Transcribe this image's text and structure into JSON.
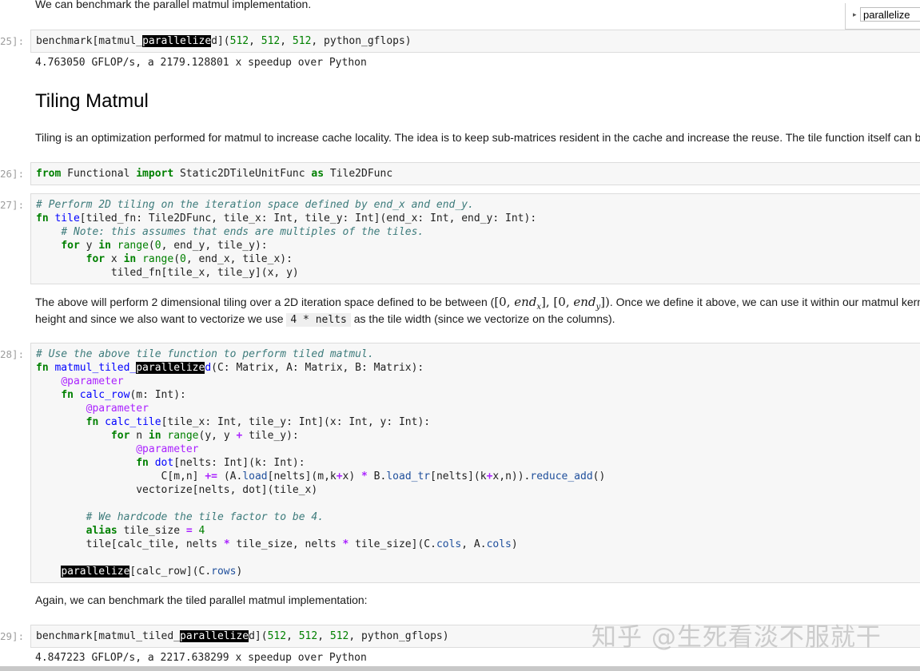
{
  "search": {
    "value": "parallelize"
  },
  "top_text": "We can benchmark the parallel matmul implementation.",
  "cells": {
    "c25": {
      "prompt": "25]:",
      "pre": "benchmark[matmul_",
      "hl": "parallelize",
      "post": "d](",
      "a1": "512",
      "a2": "512",
      "a3": "512",
      "tail": ", python_gflops)",
      "output": "4.763050 GFLOP/s, a 2179.128801 x speedup over Python"
    },
    "c26": {
      "prompt": "26]:",
      "k1": "from",
      "mod": " Functional ",
      "k2": "import",
      "name": " Static2DTileUnitFunc ",
      "k3": "as",
      "alias": " Tile2DFunc"
    },
    "c27": {
      "prompt": "27]:",
      "l1": "# Perform 2D tiling on the iteration space defined by end_x and end_y.",
      "l2_kw": "fn",
      "l2_fn": "tile",
      "l2_rest": "[tiled_fn: Tile2DFunc, tile_x: Int, tile_y: Int](end_x: Int, end_y: Int):",
      "l3": "# Note: this assumes that ends are multiples of the tiles.",
      "l4_kw": "for",
      "l4_a": " y ",
      "l4_in": "in",
      "l4_fn": " range",
      "l4_p": "(",
      "l4_n": "0",
      "l4_r": ", end_y, tile_y):",
      "l5_kw": "for",
      "l5_a": " x ",
      "l5_in": "in",
      "l5_fn": " range",
      "l5_p": "(",
      "l5_n": "0",
      "l5_r": ", end_x, tile_x):",
      "l6": "tiled_fn[tile_x, tile_y](x, y)"
    },
    "c28": {
      "prompt": "28]:",
      "l1": "# Use the above tile function to perform tiled matmul.",
      "l2_kw": "fn",
      "l2_fn_a": "matmul_tiled_",
      "l2_hl": "parallelize",
      "l2_fn_b": "d",
      "l2_rest": "(C: Matrix, A: Matrix, B: Matrix):",
      "l3": "@parameter",
      "l4_kw": "fn",
      "l4_fn": "calc_row",
      "l4_rest": "(m: Int):",
      "l5": "@parameter",
      "l6_kw": "fn",
      "l6_fn": "calc_tile",
      "l6_rest": "[tile_x: Int, tile_y: Int](x: Int, y: Int):",
      "l7_kw": "for",
      "l7_a": " n ",
      "l7_in": "in",
      "l7_fn": " range",
      "l7_p1": "(y, y ",
      "l7_op": "+",
      "l7_p2": " tile_y):",
      "l8": "@parameter",
      "l9_kw": "fn",
      "l9_fn": "dot",
      "l9_rest": "[nelts: Int](k: Int):",
      "l10_a": "C[m,n] ",
      "l10_op1": "+=",
      "l10_b": " (A.",
      "l10_at1": "load",
      "l10_c": "[nelts](m,k",
      "l10_op2": "+",
      "l10_d": "x) ",
      "l10_op3": "*",
      "l10_e": " B.",
      "l10_at2": "load_tr",
      "l10_f": "[nelts](k",
      "l10_op4": "+",
      "l10_g": "x,n)).",
      "l10_at3": "reduce_add",
      "l10_h": "()",
      "l11": "vectorize[nelts, dot](tile_x)",
      "l12": "# We hardcode the tile factor to be 4.",
      "l13_kw": "alias",
      "l13_a": " tile_size ",
      "l13_op": "=",
      "l13_n": " 4",
      "l14_a": "tile[calc_tile, nelts ",
      "l14_op1": "*",
      "l14_b": " tile_size, nelts ",
      "l14_op2": "*",
      "l14_c": " tile_size](C.",
      "l14_at1": "cols",
      "l14_d": ", A.",
      "l14_at2": "cols",
      "l14_e": ")",
      "l15_hl": "parallelize",
      "l15_a": "[calc_row](C.",
      "l15_at": "rows",
      "l15_b": ")"
    },
    "c29": {
      "prompt": "29]:",
      "pre": "benchmark[matmul_tiled_",
      "hl": "parallelize",
      "post": "d](",
      "a1": "512",
      "a2": "512",
      "a3": "512",
      "tail": ", python_gflops)",
      "output": "4.847223 GFLOP/s, a 2217.638299 x speedup over Python"
    }
  },
  "heading": "Tiling Matmul",
  "para1": "Tiling is an optimization performed for matmul to increase cache locality. The idea is to keep sub-matrices resident in the cache and increase the reuse. The tile function itself can b",
  "para2": {
    "a": "The above will perform 2 dimensional tiling over a 2D iteration space defined to be between (",
    "m1": "[0, ",
    "m1v": "end",
    "m1s": "x",
    "m2": "], [0, ",
    "m2v": "end",
    "m2s": "y",
    "m3": "])",
    "b": ". Once we define it above, we can use it within our matmul kerne",
    "c": "height and since we also want to vectorize we use ",
    "code": "4 * nelts",
    "d": " as the tile width (since we vectorize on the columns)."
  },
  "para3": "Again, we can benchmark the tiled parallel matmul implementation:",
  "watermark": "知乎 @生死看淡不服就干"
}
